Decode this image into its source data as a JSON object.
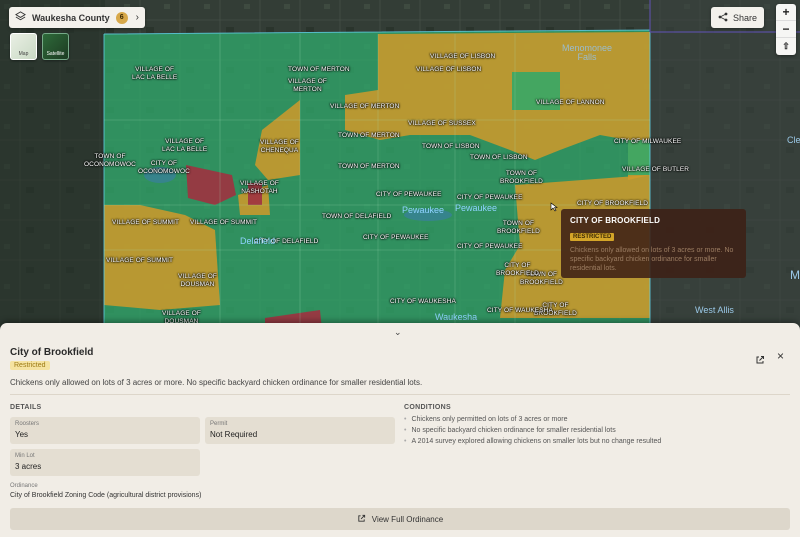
{
  "header": {
    "county_name": "Waukesha County",
    "county_count": "6",
    "chevron": "›"
  },
  "layers": {
    "map_label": "Map",
    "satellite_label": "Satellite"
  },
  "share": {
    "label": "Share"
  },
  "zoom": {
    "in": "+",
    "out": "−",
    "reset": "⇧"
  },
  "colors": {
    "allowed": "#2fa86a",
    "restricted": "#d09a2a",
    "prohibited": "#a03240"
  },
  "map_labels": [
    "VILLAGE OF\nLAC LA BELLE",
    "TOWN OF MERTON",
    "VILLAGE OF LISBON",
    "VILLAGE OF LISBON",
    "VILLAGE OF\nMERTON",
    "VILLAGE OF LANNON",
    "VILLAGE OF MERTON",
    "VILLAGE OF SUSSEX",
    "VILLAGE OF\nLAC LA BELLE",
    "VILLAGE OF\nCHENEQUA",
    "TOWN OF MERTON",
    "TOWN OF LISBON",
    "TOWN OF\nOCONOMOWOC",
    "CITY OF\nOCONOMOWOC",
    "TOWN OF LISBON",
    "CITY OF MILWAUKEE",
    "VILLAGE OF\nNASHOTAH",
    "TOWN OF MERTON",
    "TOWN OF\nBROOKFIELD",
    "VILLAGE OF BUTLER",
    "CITY OF PEWAUKEE",
    "CITY OF PEWAUKEE",
    "CITY OF BROOKFIELD",
    "VILLAGE OF SUMMIT",
    "VILLAGE OF SUMMIT",
    "TOWN OF DELAFIELD",
    "TOWN OF\nBROOKFIELD",
    "CITY OF DELAFIELD",
    "CITY OF PEWAUKEE",
    "CITY OF PEWAUKEE",
    "VILLAGE OF SUMMIT",
    "VILLAGE OF\nDOUSMAN",
    "TOWN OF\nBROOKFIELD",
    "CITY OF WAUKESHA",
    "CITY OF\nBROOKFIELD",
    "CITY OF WAUKESHA",
    "CITY OF\nBROOKFIELD",
    "VILLAGE OF\nDOUSMAN"
  ],
  "city_labels": [
    "Menomonee\nFalls",
    "Pewaukee",
    "Pewaukee",
    "Delafield",
    "Waukesha",
    "West Allis",
    "Cle",
    "M"
  ],
  "tooltip": {
    "title": "CITY OF BROOKFIELD",
    "badge": "RESTRICTED",
    "desc": "Chickens only allowed on lots of 3 acres or more. No specific backyard chicken ordinance for smaller residential lots."
  },
  "panel": {
    "collapse": "⌄",
    "title": "City of Brookfield",
    "badge": "Restricted",
    "close": "×",
    "summary": "Chickens only allowed on lots of 3 acres or more. No specific backyard chicken ordinance for smaller residential lots.",
    "details_heading": "DETAILS",
    "conditions_heading": "CONDITIONS",
    "fields": {
      "roosters_label": "Roosters",
      "roosters_value": "Yes",
      "permit_label": "Permit",
      "permit_value": "Not Required",
      "minlot_label": "Min Lot",
      "minlot_value": "3 acres"
    },
    "ordinance_label": "Ordinance",
    "ordinance_value": "City of Brookfield Zoning Code (agricultural district provisions)",
    "conditions": [
      "Chickens only permitted on lots of 3 acres or more",
      "No specific backyard chicken ordinance for smaller residential lots",
      "A 2014 survey explored allowing chickens on smaller lots but no change resulted"
    ],
    "button_label": "View Full Ordinance"
  }
}
